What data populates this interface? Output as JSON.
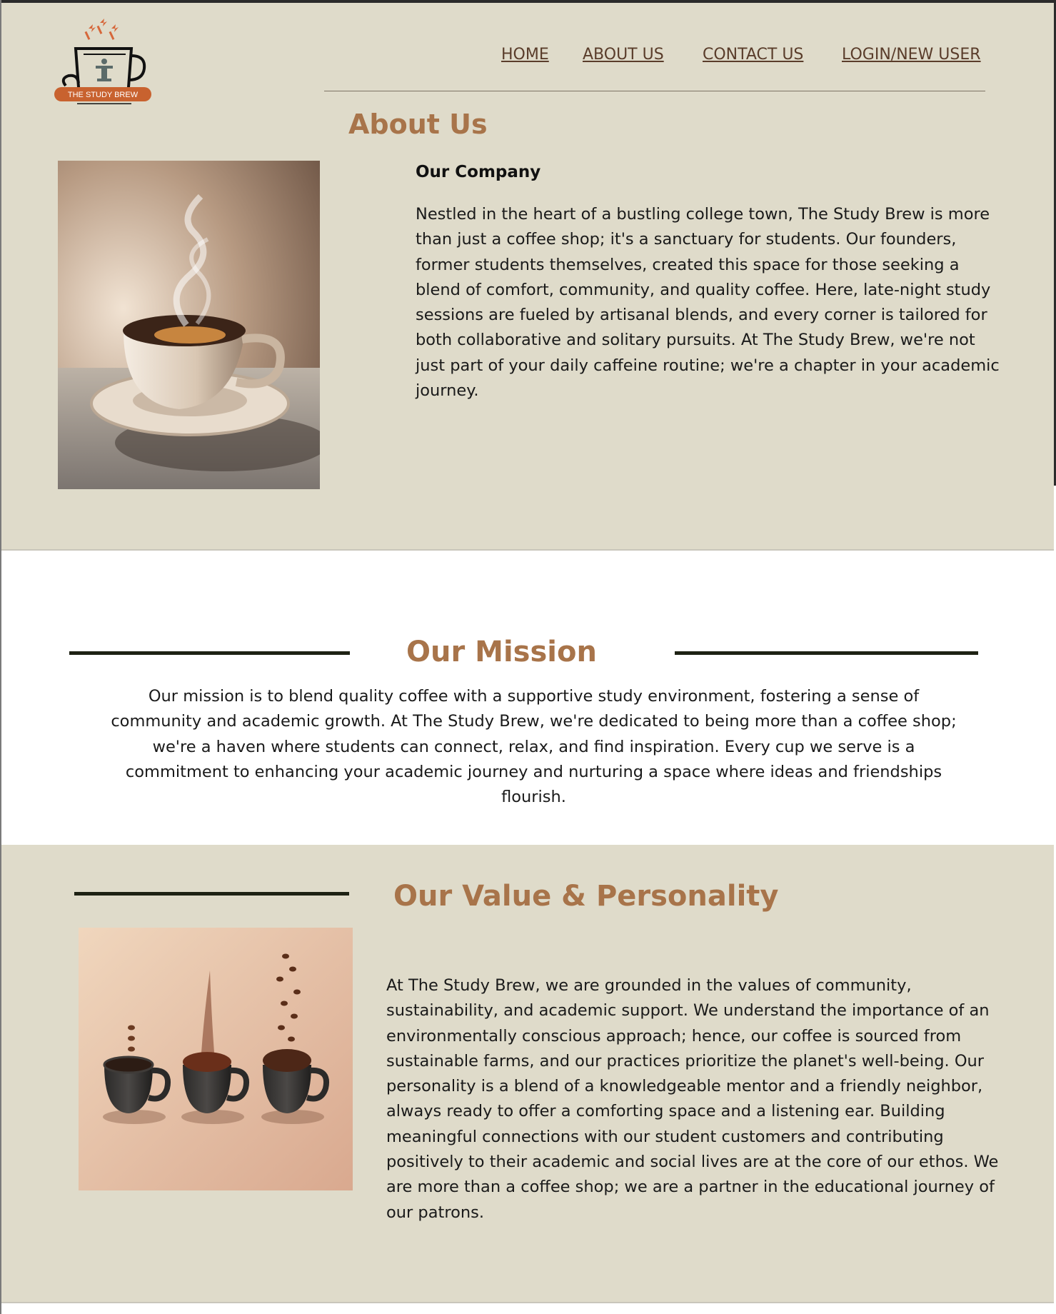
{
  "brand": {
    "logo_text": "THE STUDY BREW",
    "colors": {
      "accent": "#a8744a",
      "background": "#dfdbca",
      "logo_band": "#c8622f",
      "rule": "#1e2214"
    }
  },
  "nav": {
    "items": [
      {
        "label": "HOME"
      },
      {
        "label": "ABOUT US"
      },
      {
        "label": "CONTACT US"
      },
      {
        "label": "LOGIN/NEW USER"
      }
    ]
  },
  "about": {
    "title": "About Us",
    "image_icon": "steaming-coffee-cup-photo",
    "subtitle": "Our Company",
    "text": "Nestled in the heart of a bustling college town, The Study Brew is more than just a coffee shop; it's a sanctuary for students. Our founders, former students themselves, created this space for those seeking a blend of comfort, community, and quality coffee. Here, late-night study sessions are fueled by artisanal blends, and every corner is tailored for both collaborative and solitary pursuits. At The Study Brew, we're not just part of your daily caffeine routine; we're a chapter in your academic journey."
  },
  "mission": {
    "title": "Our Mission",
    "text": "Our mission is to blend quality coffee with a supportive study environment, fostering a sense of community and academic growth. At The Study Brew, we're dedicated to being more than a coffee shop; we're a haven where students can connect, relax, and find inspiration. Every cup we serve is a commitment to enhancing your academic journey and nurturing a space where ideas and friendships flourish."
  },
  "values": {
    "title": "Our Value & Personality",
    "image_icon": "three-coffee-cups-photo",
    "text": "At The Study Brew, we are grounded in the values of community, sustainability, and academic support. We understand the importance of an environmentally conscious approach; hence, our coffee is sourced from sustainable farms, and our practices prioritize the planet's well-being. Our personality is a blend of a knowledgeable mentor and a friendly neighbor, always ready to offer a comforting space and a listening ear. Building meaningful connections with our student customers and contributing positively to their academic and social lives are at the core of our ethos. We are more than a coffee shop; we are a partner in the educational journey of our patrons."
  }
}
